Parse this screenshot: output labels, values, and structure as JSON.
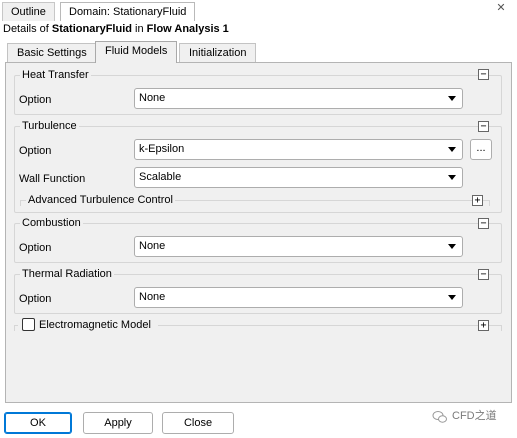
{
  "window_tabs": [
    "Outline",
    "Domain: StationaryFluid"
  ],
  "close_glyph": "✕",
  "details": {
    "prefix": "Details of ",
    "object": "StationaryFluid",
    "middle": " in ",
    "analysis": "Flow Analysis 1"
  },
  "tabs": [
    "Basic Settings",
    "Fluid Models",
    "Initialization"
  ],
  "collapse_glyph": "−",
  "expand_glyph": "+",
  "heat_transfer": {
    "title": "Heat Transfer",
    "option_label": "Option",
    "option_value": "None"
  },
  "turbulence": {
    "title": "Turbulence",
    "option_label": "Option",
    "option_value": "k-Epsilon",
    "more_button": "...",
    "wall_function_label": "Wall Function",
    "wall_function_value": "Scalable",
    "advanced_title": "Advanced Turbulence Control"
  },
  "combustion": {
    "title": "Combustion",
    "option_label": "Option",
    "option_value": "None"
  },
  "thermal_radiation": {
    "title": "Thermal Radiation",
    "option_label": "Option",
    "option_value": "None"
  },
  "electromagnetic": {
    "title": "Electromagnetic Model",
    "checked": false
  },
  "buttons": {
    "ok": "OK",
    "apply": "Apply",
    "close": "Close"
  },
  "watermark": "CFD之道",
  "colors": {
    "focus_border": "#0078d7",
    "panel_bg": "#f0f0f0"
  }
}
